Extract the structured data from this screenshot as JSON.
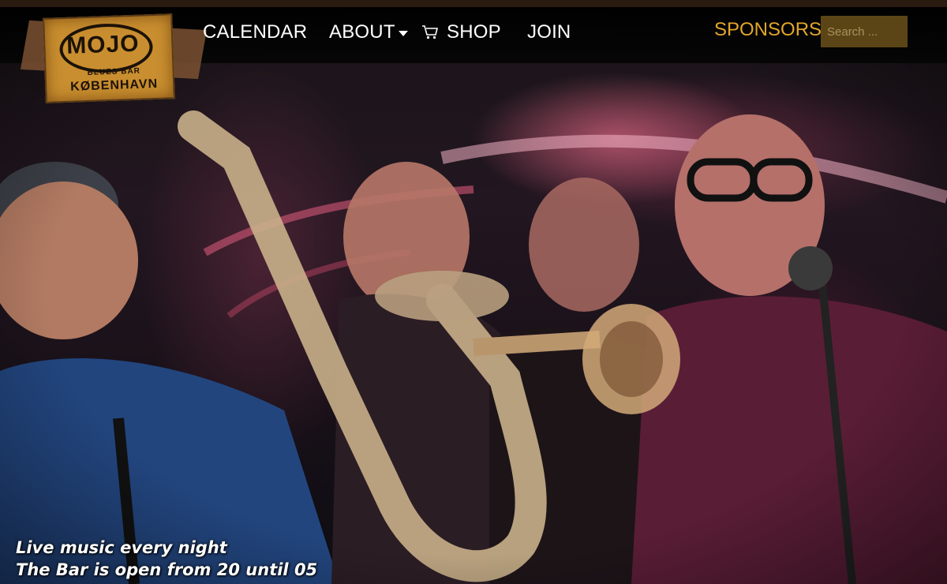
{
  "logo": {
    "word": "MOJO",
    "line1": "BLUES BAR",
    "line2": "KØBENHAVN"
  },
  "nav": {
    "calendar": "CALENDAR",
    "about": "ABOUT",
    "shop": "SHOP",
    "join": "JOIN",
    "sponsors": "SPONSORS"
  },
  "search": {
    "placeholder": "Search ..."
  },
  "hero": {
    "line1": "Live music every night",
    "line2": "The Bar is open from 20 until 05"
  },
  "colors": {
    "accent": "#e3a62a",
    "search_bg": "#5b4516",
    "nav_bg": "#050505"
  },
  "icons": {
    "cart": "cart-icon",
    "about_dropdown": "chevron-down-icon"
  }
}
